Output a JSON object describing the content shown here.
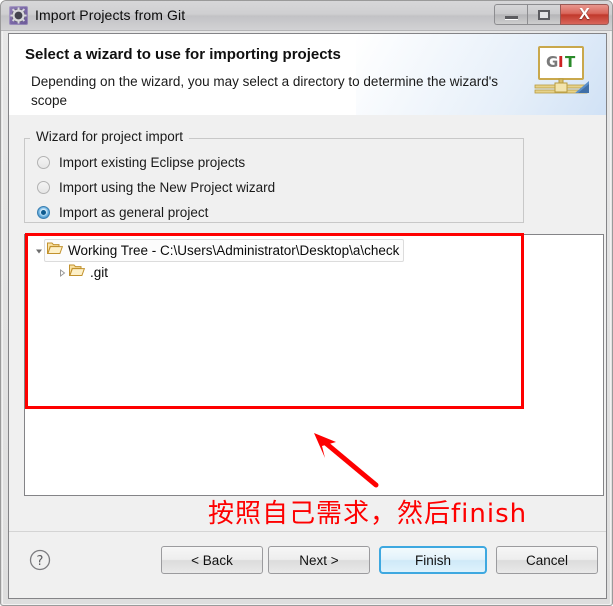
{
  "window": {
    "title": "Import Projects from Git",
    "icon": "gear-icon",
    "controls": {
      "minimize": "–",
      "maximize": "□",
      "close": "X"
    }
  },
  "banner": {
    "title": "Select a wizard to use for importing projects",
    "description": "Depending on the wizard, you may select a directory to determine the wizard's scope",
    "logo": {
      "name": "git-logo-icon",
      "letters": [
        "G",
        "I",
        "T"
      ],
      "colors": [
        "#7a7a7a",
        "#cc2222",
        "#2a8a2a"
      ]
    }
  },
  "group": {
    "label": "Wizard for project import",
    "options": [
      {
        "label": "Import existing Eclipse projects",
        "selected": false
      },
      {
        "label": "Import using the New Project wizard",
        "selected": false
      },
      {
        "label": "Import as general project",
        "selected": true
      }
    ]
  },
  "tree": {
    "items": [
      {
        "label": "Working Tree - C:\\Users\\Administrator\\Desktop\\a\\check",
        "level": 0,
        "expanded": true,
        "selected": true,
        "icon": "open-folder-icon",
        "twisty": "chevron-down-icon"
      },
      {
        "label": ".git",
        "level": 1,
        "expanded": false,
        "selected": false,
        "icon": "open-folder-icon",
        "twisty": "chevron-right-icon"
      }
    ]
  },
  "annotations": {
    "highlight_color": "#fe0000",
    "note_text": "按照自己需求，然后finish",
    "arrow": "arrow-up-left-icon",
    "rectangle": "highlight-rectangle"
  },
  "buttons": {
    "help": "?",
    "back": "< Back",
    "next": "Next >",
    "finish": "Finish",
    "cancel": "Cancel",
    "default_button": "Finish"
  }
}
